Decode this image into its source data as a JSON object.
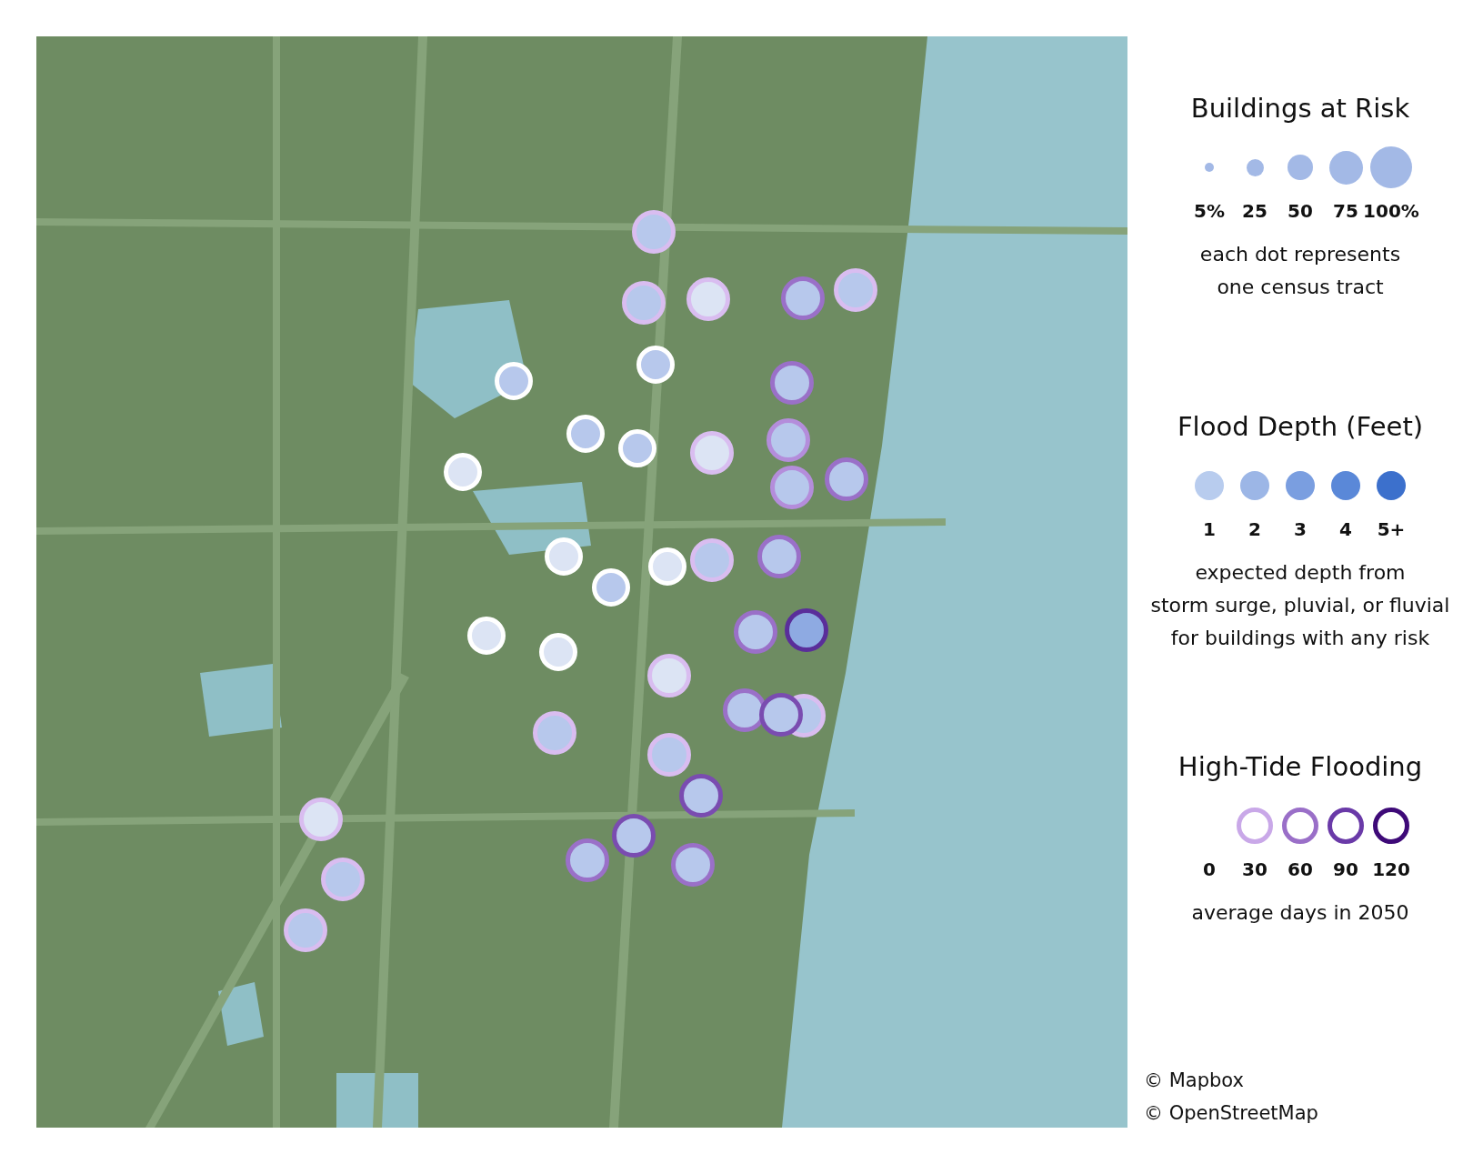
{
  "map": {
    "markers": [
      {
        "color": "#b7c8ec",
        "kind": "faint"
      },
      {
        "color": "#b7c8ec",
        "kind": "faint"
      },
      {
        "color": "#dce4f4",
        "kind": "faint"
      },
      {
        "color": "#b7c8ec",
        "kind": "medium"
      },
      {
        "color": "#b7c8ec",
        "kind": "faint"
      },
      {
        "color": "#b7c8ec",
        "kind": "none"
      },
      {
        "color": "#b7c8ec",
        "kind": "none"
      },
      {
        "color": "#b7c8ec",
        "kind": "medium"
      },
      {
        "color": "#b7c8ec",
        "kind": "none"
      },
      {
        "color": "#b7c8ec",
        "kind": "none"
      },
      {
        "color": "#dce4f4",
        "kind": "faint"
      },
      {
        "color": "#b7c8ec",
        "kind": "light"
      },
      {
        "color": "#dce4f4",
        "kind": "none"
      },
      {
        "color": "#b7c8ec",
        "kind": "light"
      },
      {
        "color": "#b7c8ec",
        "kind": "medium"
      },
      {
        "color": "#dce4f4",
        "kind": "none"
      },
      {
        "color": "#b7c8ec",
        "kind": "none"
      },
      {
        "color": "#dce4f4",
        "kind": "none"
      },
      {
        "color": "#b7c8ec",
        "kind": "faint"
      },
      {
        "color": "#b7c8ec",
        "kind": "medium"
      },
      {
        "color": "#dce4f4",
        "kind": "none"
      },
      {
        "color": "#dce4f4",
        "kind": "none"
      },
      {
        "color": "#b7c8ec",
        "kind": "medium"
      },
      {
        "color": "#8eaae2",
        "kind": "dark"
      },
      {
        "color": "#dce4f4",
        "kind": "faint"
      },
      {
        "color": "#b7c8ec",
        "kind": "medium"
      },
      {
        "color": "#b7c8ec",
        "kind": "faint"
      },
      {
        "color": "#b7c8ec",
        "kind": "strong"
      },
      {
        "color": "#b7c8ec",
        "kind": "faint"
      },
      {
        "color": "#b7c8ec",
        "kind": "faint"
      },
      {
        "color": "#b7c8ec",
        "kind": "strong"
      },
      {
        "color": "#b7c8ec",
        "kind": "strong"
      },
      {
        "color": "#b7c8ec",
        "kind": "medium"
      },
      {
        "color": "#b7c8ec",
        "kind": "medium"
      },
      {
        "color": "#dce4f4",
        "kind": "faint"
      },
      {
        "color": "#b7c8ec",
        "kind": "faint"
      },
      {
        "color": "#b7c8ec",
        "kind": "faint"
      }
    ]
  },
  "legend": {
    "size": {
      "title": "Buildings at Risk",
      "items": [
        {
          "label": "5%"
        },
        {
          "label": "25"
        },
        {
          "label": "50"
        },
        {
          "label": "75"
        },
        {
          "label": "100%"
        }
      ],
      "caption": [
        "each dot represents",
        "one census tract"
      ]
    },
    "depth": {
      "title": "Flood Depth (Feet)",
      "items": [
        {
          "label": "1",
          "color": "#b8ccee"
        },
        {
          "label": "2",
          "color": "#9cb6e6"
        },
        {
          "label": "3",
          "color": "#7a9ee0"
        },
        {
          "label": "4",
          "color": "#5a88d8"
        },
        {
          "label": "5+",
          "color": "#3c70cc"
        }
      ],
      "caption": [
        "expected depth from",
        "storm surge, pluvial, or fluvial",
        "for buildings with any risk"
      ]
    },
    "tide": {
      "title": "High-Tide Flooding",
      "items": [
        {
          "label": "0"
        },
        {
          "label": "30",
          "color": "#c9a8e8"
        },
        {
          "label": "60",
          "color": "#9a6fc8"
        },
        {
          "label": "90",
          "color": "#6a3aa8"
        },
        {
          "label": "120",
          "color": "#3e0a78"
        }
      ],
      "caption": [
        "average days in 2050"
      ]
    }
  },
  "attribution": [
    "© Mapbox",
    "© OpenStreetMap"
  ]
}
